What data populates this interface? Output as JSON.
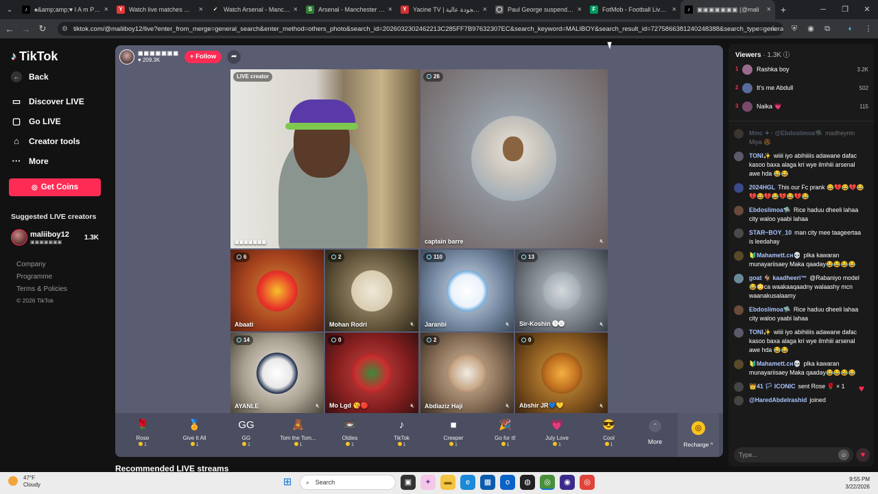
{
  "browser": {
    "tabs": [
      {
        "title": "♠&amp;amp;♥ I A m P a R D ♥",
        "fav": "♪",
        "fav_bg": "#000",
        "fav_fg": "#fff"
      },
      {
        "title": "Watch live matches — Ya",
        "fav": "Y",
        "fav_bg": "#e53935",
        "fav_fg": "#fff"
      },
      {
        "title": "Watch Arsenal - Manchest",
        "fav": "✓",
        "fav_bg": "#222",
        "fav_fg": "#fff"
      },
      {
        "title": "Arsenal - Manchester City",
        "fav": "S",
        "fav_bg": "#2e7d32",
        "fav_fg": "#fff"
      },
      {
        "title": "Yacine TV | يوم مجودة عالية",
        "fav": "Y",
        "fav_bg": "#d32f2f",
        "fav_fg": "#fff"
      },
      {
        "title": "Paul George suspended fo",
        "fav": "◯",
        "fav_bg": "#555",
        "fav_fg": "#fff"
      },
      {
        "title": "FotMob - Football Live Sc",
        "fav": "F",
        "fav_bg": "#00985f",
        "fav_fg": "#fff"
      },
      {
        "title": "▣▣▣▣▣▣▣ (@mali",
        "fav": "♪",
        "fav_bg": "#000",
        "fav_fg": "#fff"
      }
    ],
    "url": "tiktok.com/@maliiboy12/live?enter_from_merge=general_search&enter_method=others_photo&search_id=2026032302462213C285FF7B97632307EC&search_keyword=MALIBOY&search_result_id=7275866381240248388&search_type=general"
  },
  "sidebar": {
    "logo": "TikTok",
    "back": "Back",
    "nav": [
      "Discover LIVE",
      "Go LIVE",
      "Creator tools",
      "More"
    ],
    "get_coins": "Get Coins",
    "suggested_title": "Suggested LIVE creators",
    "suggested": {
      "name": "maliiboy12",
      "sub": "▣▣▣▣▣▣▣",
      "count": "1.3K"
    },
    "footer": [
      "Company",
      "Programme",
      "Terms & Policies"
    ],
    "copyright": "© 2026 TikTok"
  },
  "live": {
    "host_name": "▣▣▣▣▣▣▣",
    "host_likes": "♥ 209.3K",
    "follow": "+ Follow",
    "main_left_badge": "LIVE creator",
    "main_left_name": "▣▣▣▣▣▣▣",
    "main_right_count": "26",
    "main_right_name": "captain barre",
    "tiles": [
      {
        "count": "6",
        "name": "Abaati"
      },
      {
        "count": "2",
        "name": "Mohan Rodri"
      },
      {
        "count": "110",
        "name": "Jaranbi"
      },
      {
        "count": "13",
        "name": "Sir-Koshin 🅢🅐"
      },
      {
        "count": "14",
        "name": "AYANLE"
      },
      {
        "count": "0",
        "name": "Mo Lgd 😘🔴"
      },
      {
        "count": "2",
        "name": "Abdiaziz Haji"
      },
      {
        "count": "0",
        "name": "Abshir JR💙💛"
      }
    ],
    "gifts": [
      {
        "name": "Rose",
        "price": "1",
        "icon": "🌹"
      },
      {
        "name": "Give It All",
        "price": "1",
        "icon": "🏅"
      },
      {
        "name": "GG",
        "price": "1",
        "icon": "GG"
      },
      {
        "name": "Tom the Tom...",
        "price": "1",
        "icon": "🧸"
      },
      {
        "name": "Oldies",
        "price": "1",
        "icon": "📼"
      },
      {
        "name": "TikTok",
        "price": "1",
        "icon": "♪"
      },
      {
        "name": "Creeper",
        "price": "1",
        "icon": "■"
      },
      {
        "name": "Go for it!",
        "price": "1",
        "icon": "🎉"
      },
      {
        "name": "July Love",
        "price": "1",
        "icon": "💗"
      },
      {
        "name": "Cool",
        "price": "1",
        "icon": "😎"
      }
    ],
    "more": "More",
    "recharge": "Recharge ^",
    "recommended": "Recommended LIVE streams"
  },
  "chat": {
    "viewers_label": "Viewers",
    "viewers_count": "· 1.3K",
    "top_viewers": [
      {
        "rank": "1",
        "name": "Rashka boy",
        "score": "3.2K"
      },
      {
        "rank": "2",
        "name": "It's me Abdull",
        "score": "502"
      },
      {
        "rank": "3",
        "name": "Nalka 💗",
        "score": "115"
      }
    ],
    "messages": [
      {
        "user": "Mmc ✦ · @Ebdoslimoa🛸",
        "text": "madheynin Miya 😍",
        "fade": true
      },
      {
        "user": "TONI✨",
        "text": "wiiii iyo abihiiiis adawane dafac kasoo baxa alaga kri wye ilmhiii arsenal awe hda 😂😂"
      },
      {
        "user": "2024HGL",
        "text": "This our Fc prank 😂💔😂💔😂💔😂💔😂💔😂💔😂"
      },
      {
        "user": "Ebdoslimoa🛸",
        "text": "Rice haduu dheeli lahaa city waloo yaabi lahaa"
      },
      {
        "user": "STAR~BOY_10",
        "text": "man city mee taageertaa is leedahay"
      },
      {
        "user": "🔰Mahamett.ᴄʜ💀",
        "text": "plka kawaran munayariisaey Maka qaaday😂😂😂😂"
      },
      {
        "user": "goat 🐐 kaadheeri™",
        "text": "@Rabaniyo model😂😳ca waakaaqaadny walaashy mcn waanakusalaamy"
      },
      {
        "user": "Ebdoslimoa🛸",
        "text": "Rice haduu dheeli lahaa city waloo yaabi lahaa"
      },
      {
        "user": "TONI✨",
        "text": "wiiii iyo abihiiiis adawane dafac kasoo baxa alaga kri wye ilmhiii arsenal awe hda 😂😂"
      },
      {
        "user": "🔰Mahamett.ᴄʜ💀",
        "text": "plka kawaran munayariisaey Maka qaaday😂😂😂😂"
      },
      {
        "user": "👑41 🏳 ICONIC",
        "text": "sent Rose 🌹 × 1"
      },
      {
        "user": "@HaredAbdelrashid",
        "text": "joined"
      }
    ],
    "input_placeholder": "Type..."
  },
  "taskbar": {
    "temp": "47°F",
    "condition": "Cloudy",
    "search": "Search",
    "time": "9:55 PM",
    "date": "3/22/2026"
  }
}
